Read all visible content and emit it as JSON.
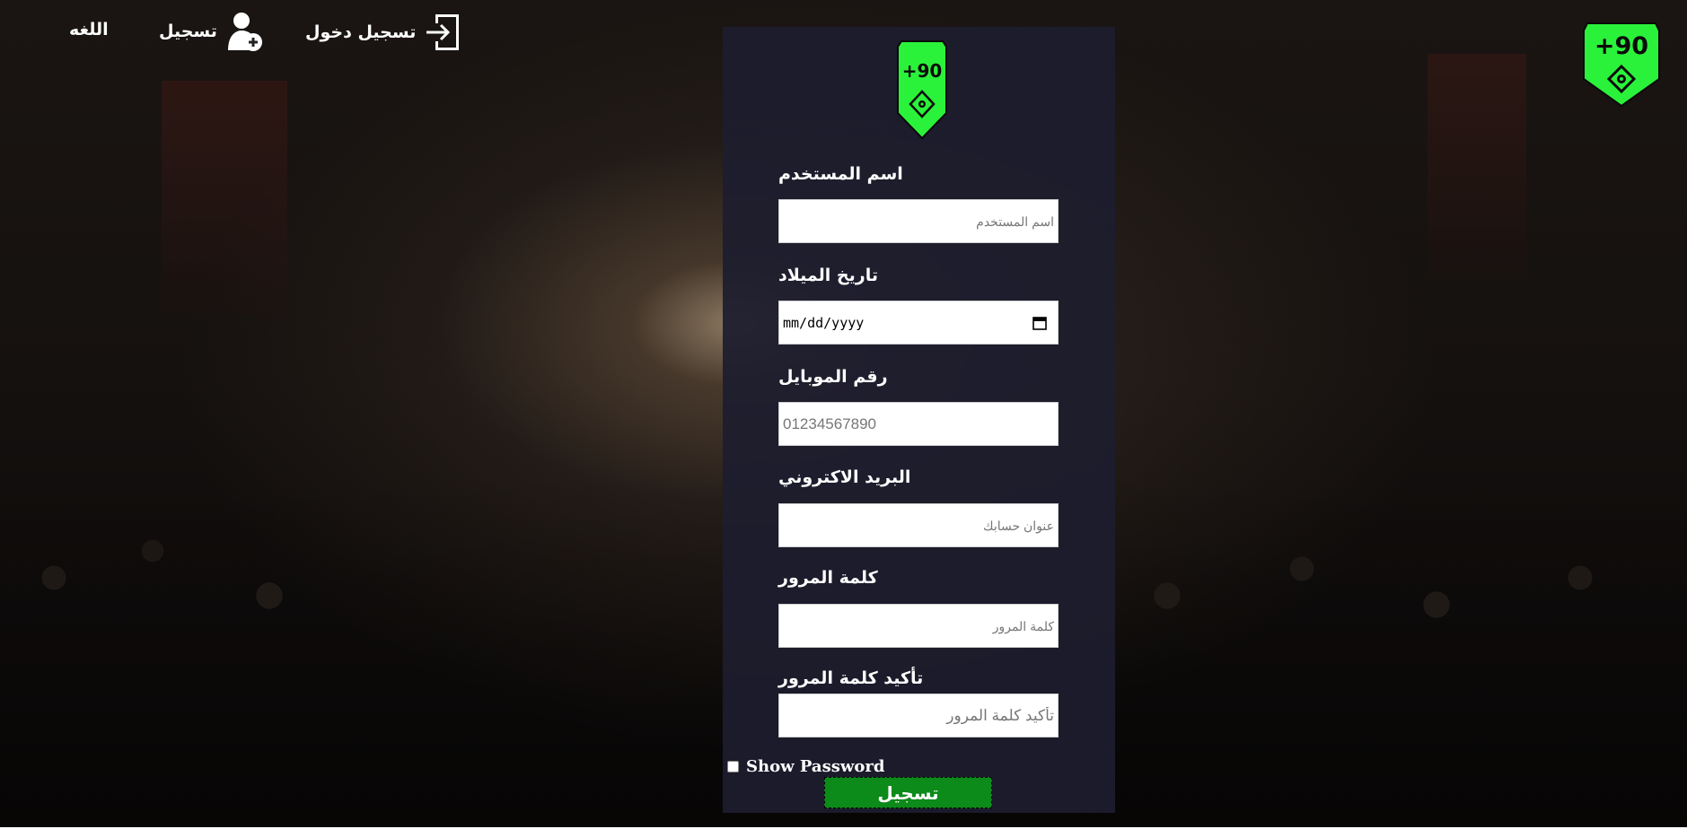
{
  "nav": {
    "language_label": "اللغه",
    "register_label": "تسجيل",
    "login_label": "تسجيل دخول"
  },
  "logo": {
    "text": "+90",
    "color": "#2af23a"
  },
  "form": {
    "fields": [
      {
        "label": "اسم المستخدم",
        "placeholder": "اسم المستخدم"
      },
      {
        "label": "تاريخ الميلاد",
        "value": "mm/dd/yyyy"
      },
      {
        "label": "رقم الموبايل",
        "placeholder": "01234567890"
      },
      {
        "label": "البريد الاكتروني",
        "placeholder": "عنوان حسابك"
      },
      {
        "label": "كلمة المرور",
        "placeholder": "كلمة المرور"
      },
      {
        "label": "تأكيد كلمة المرور",
        "placeholder": "تأكيد كلمة المرور"
      }
    ],
    "show_password_label": "Show Password",
    "submit_label": "تسجيل"
  },
  "colors": {
    "accent_green": "#2af23a",
    "button_green": "#0c8a1a",
    "panel": "#1d1d2e"
  }
}
